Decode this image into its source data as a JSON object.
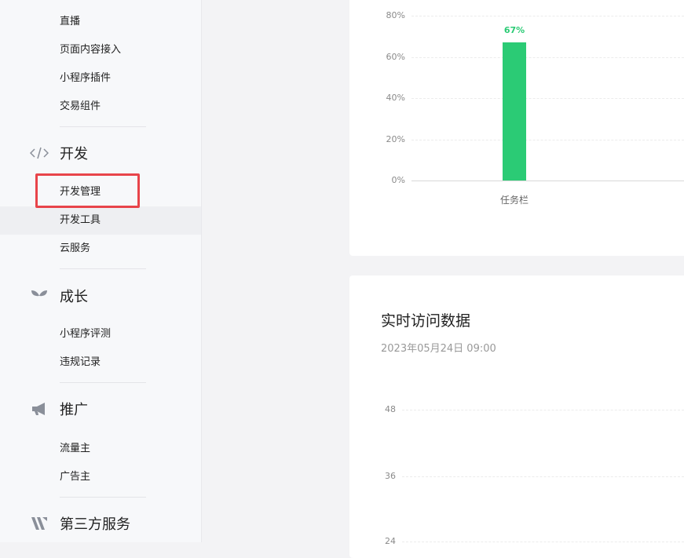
{
  "sidebar": {
    "top_items": [
      "直播",
      "页面内容接入",
      "小程序插件",
      "交易组件"
    ],
    "sections": [
      {
        "title": "开发",
        "icon": "code-icon",
        "items": [
          "开发管理",
          "开发工具",
          "云服务"
        ]
      },
      {
        "title": "成长",
        "icon": "sprout-icon",
        "items": [
          "小程序评测",
          "违规记录"
        ]
      },
      {
        "title": "推广",
        "icon": "megaphone-icon",
        "items": [
          "流量主",
          "广告主"
        ]
      },
      {
        "title": "第三方服务",
        "icon": "services-icon",
        "items": []
      }
    ]
  },
  "chart_data": [
    {
      "type": "bar",
      "categories": [
        "任务栏"
      ],
      "values": [
        67
      ],
      "data_labels": [
        "67%"
      ],
      "yticks": [
        "0%",
        "20%",
        "40%",
        "60%",
        "80%"
      ],
      "ylim": [
        0,
        80
      ],
      "grid": true
    },
    {
      "type": "line",
      "title": "实时访问数据",
      "subtitle": "2023年05月24日 09:00",
      "yticks": [
        "48",
        "36",
        "24"
      ],
      "grid": true
    }
  ],
  "colors": {
    "bar": "#2bcb75",
    "highlight": "#e8444a"
  }
}
